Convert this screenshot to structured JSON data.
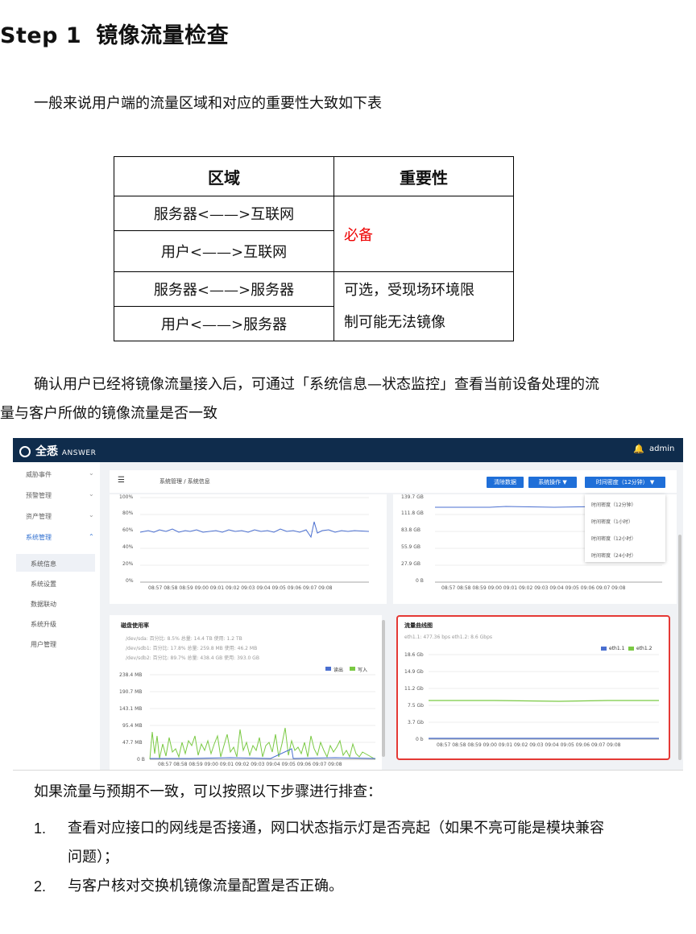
{
  "heading": {
    "num": "Step 1",
    "title": "镜像流量检查"
  },
  "intro": "一般来说用户端的流量区域和对应的重要性大致如下表",
  "table": {
    "headers": [
      "区域",
      "重要性"
    ],
    "rows": [
      "服务器<——>互联网",
      "用户<——>互联网",
      "服务器<——>服务器",
      "用户<——>服务器"
    ],
    "importance_required": "必备",
    "importance_optional_line1": "可选，受现场环境限",
    "importance_optional_line2": "制可能无法镜像",
    "required_color": "#e00000"
  },
  "para2": {
    "line1": "确认用户已经将镜像流量接入后，可通过「系统信息—状态监控」查看当前设备处理的流",
    "line2": "量与客户所做的镜像流量是否一致"
  },
  "shot": {
    "logo": "全悉",
    "logo_sub": "ANSWER",
    "admin": "admin",
    "menu": [
      {
        "label": "威胁事件"
      },
      {
        "label": "预警管理"
      },
      {
        "label": "资产管理"
      },
      {
        "label": "系统管理"
      }
    ],
    "submenu": [
      "系统信息",
      "系统设置",
      "数据联动",
      "系统升级",
      "用户管理"
    ],
    "breadcrumb": "系统管理 / 系统信息",
    "buttons": {
      "clear": "清除数据",
      "op": "系统操作 ▼",
      "time": "时间密度（12分钟） ▼"
    },
    "dropdown": [
      "时间密度（12分钟）",
      "时间密度（1小时）",
      "时间密度（12小时）",
      "时间密度（24小时）"
    ],
    "x_ticks": "08:57 08:58 08:59 09:00 09:01 09:02 09:03 09:04 09:05 09:06 09:07 09:08",
    "cpu_axis": [
      "100%",
      "80%",
      "60%",
      "40%",
      "20%",
      "0%"
    ],
    "mem_axis": [
      "139.7 GB",
      "111.8 GB",
      "83.8 GB",
      "55.9 GB",
      "27.9 GB",
      "0 B"
    ],
    "disk": {
      "title": "磁盘使用率",
      "items": [
        "/dev/sda: 百分比: 8.5% 总量: 14.4 TB 使用: 1.2 TB",
        "/dev/sdb1: 百分比: 17.8% 总量: 259.8 MB 使用: 46.2 MB",
        "/dev/sdb2: 百分比: 89.7% 总量: 438.4 GB 使用: 393.0 GB"
      ],
      "legend": [
        "读出",
        "写入"
      ],
      "axis": [
        "238.4 MB",
        "190.7 MB",
        "143.1 MB",
        "95.4 MB",
        "47.7 MB",
        "0 B"
      ]
    },
    "traffic": {
      "title": "流量曲线图",
      "summary": "eth1.1: 477.36 bps eth1.2: 8.6 Gbps",
      "legend": [
        "eth1.1",
        "eth1.2"
      ],
      "axis": [
        "18.6 Gb",
        "14.9 Gb",
        "11.2 Gb",
        "7.5 Gb",
        "3.7 Gb",
        "0 b"
      ]
    },
    "colors": {
      "blue": "#4a6fd0",
      "green": "#7ac943",
      "highlight": "#e53935"
    }
  },
  "para3": "如果流量与预期不一致，可以按照以下步骤进行排查：",
  "steps": [
    {
      "n": "1.",
      "line1": "查看对应接口的网线是否接通，网口状态指示灯是否亮起（如果不亮可能是模块兼容",
      "line2": "问题）；"
    },
    {
      "n": "2.",
      "line1": "与客户核对交换机镜像流量配置是否正确。"
    }
  ]
}
